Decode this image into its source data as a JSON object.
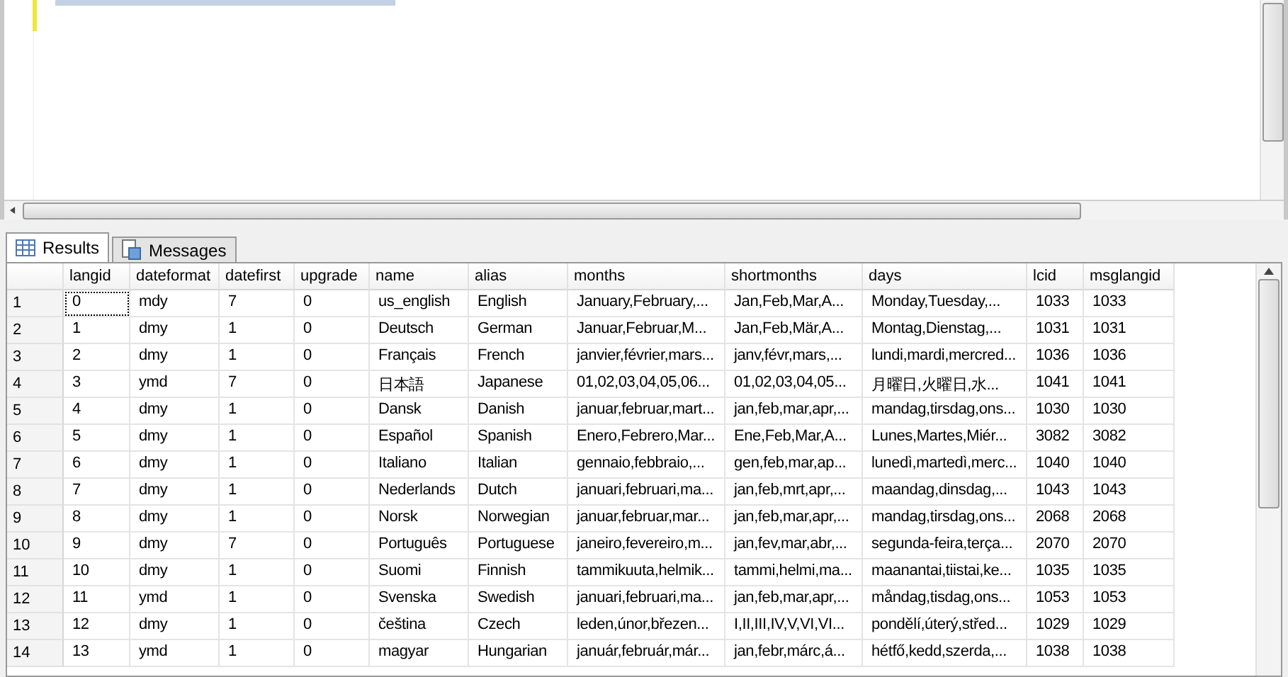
{
  "tabs": [
    {
      "label": "Results",
      "kind": "grid",
      "selected": true
    },
    {
      "label": "Messages",
      "kind": "messages",
      "selected": false
    }
  ],
  "table": {
    "columns": [
      "langid",
      "dateformat",
      "datefirst",
      "upgrade",
      "name",
      "alias",
      "months",
      "shortmonths",
      "days",
      "lcid",
      "msglangid"
    ],
    "rows": [
      {
        "number": "1",
        "focused": true,
        "cells": [
          "0",
          "mdy",
          "7",
          "0",
          "us_english",
          "English",
          "January,February,...",
          "Jan,Feb,Mar,A...",
          "Monday,Tuesday,...",
          "1033",
          "1033"
        ]
      },
      {
        "number": "2",
        "focused": false,
        "cells": [
          "1",
          "dmy",
          "1",
          "0",
          "Deutsch",
          "German",
          "Januar,Februar,M...",
          "Jan,Feb,Mär,A...",
          "Montag,Dienstag,...",
          "1031",
          "1031"
        ]
      },
      {
        "number": "3",
        "focused": false,
        "cells": [
          "2",
          "dmy",
          "1",
          "0",
          "Français",
          "French",
          "janvier,février,mars...",
          "janv,févr,mars,...",
          "lundi,mardi,mercred...",
          "1036",
          "1036"
        ]
      },
      {
        "number": "4",
        "focused": false,
        "cells": [
          "3",
          "ymd",
          "7",
          "0",
          "日本語",
          "Japanese",
          "01,02,03,04,05,06...",
          "01,02,03,04,05...",
          "月曜日,火曜日,水...",
          "1041",
          "1041"
        ]
      },
      {
        "number": "5",
        "focused": false,
        "cells": [
          "4",
          "dmy",
          "1",
          "0",
          "Dansk",
          "Danish",
          "januar,februar,mart...",
          "jan,feb,mar,apr,...",
          "mandag,tirsdag,ons...",
          "1030",
          "1030"
        ]
      },
      {
        "number": "6",
        "focused": false,
        "cells": [
          "5",
          "dmy",
          "1",
          "0",
          "Español",
          "Spanish",
          "Enero,Febrero,Mar...",
          "Ene,Feb,Mar,A...",
          "Lunes,Martes,Miér...",
          "3082",
          "3082"
        ]
      },
      {
        "number": "7",
        "focused": false,
        "cells": [
          "6",
          "dmy",
          "1",
          "0",
          "Italiano",
          "Italian",
          "gennaio,febbraio,...",
          "gen,feb,mar,ap...",
          "lunedì,martedì,merc...",
          "1040",
          "1040"
        ]
      },
      {
        "number": "8",
        "focused": false,
        "cells": [
          "7",
          "dmy",
          "1",
          "0",
          "Nederlands",
          "Dutch",
          "januari,februari,ma...",
          "jan,feb,mrt,apr,...",
          "maandag,dinsdag,...",
          "1043",
          "1043"
        ]
      },
      {
        "number": "9",
        "focused": false,
        "cells": [
          "8",
          "dmy",
          "1",
          "0",
          "Norsk",
          "Norwegian",
          "januar,februar,mar...",
          "jan,feb,mar,apr,...",
          "mandag,tirsdag,ons...",
          "2068",
          "2068"
        ]
      },
      {
        "number": "10",
        "focused": false,
        "cells": [
          "9",
          "dmy",
          "7",
          "0",
          "Português",
          "Portuguese",
          "janeiro,fevereiro,m...",
          "jan,fev,mar,abr,...",
          "segunda-feira,terça...",
          "2070",
          "2070"
        ]
      },
      {
        "number": "11",
        "focused": false,
        "cells": [
          "10",
          "dmy",
          "1",
          "0",
          "Suomi",
          "Finnish",
          "tammikuuta,helmik...",
          "tammi,helmi,ma...",
          "maanantai,tiistai,ke...",
          "1035",
          "1035"
        ]
      },
      {
        "number": "12",
        "focused": false,
        "cells": [
          "11",
          "ymd",
          "1",
          "0",
          "Svenska",
          "Swedish",
          "januari,februari,ma...",
          "jan,feb,mar,apr,...",
          "måndag,tisdag,ons...",
          "1053",
          "1053"
        ]
      },
      {
        "number": "13",
        "focused": false,
        "cells": [
          "12",
          "dmy",
          "1",
          "0",
          "čeština",
          "Czech",
          "leden,únor,březen...",
          "I,II,III,IV,V,VI,VI...",
          "pondělí,úterý,střed...",
          "1029",
          "1029"
        ]
      },
      {
        "number": "14",
        "focused": false,
        "cells": [
          "13",
          "ymd",
          "1",
          "0",
          "magyar",
          "Hungarian",
          "január,február,már...",
          "jan,febr,márc,á...",
          "hétfő,kedd,szerda,...",
          "1038",
          "1038"
        ]
      }
    ]
  }
}
